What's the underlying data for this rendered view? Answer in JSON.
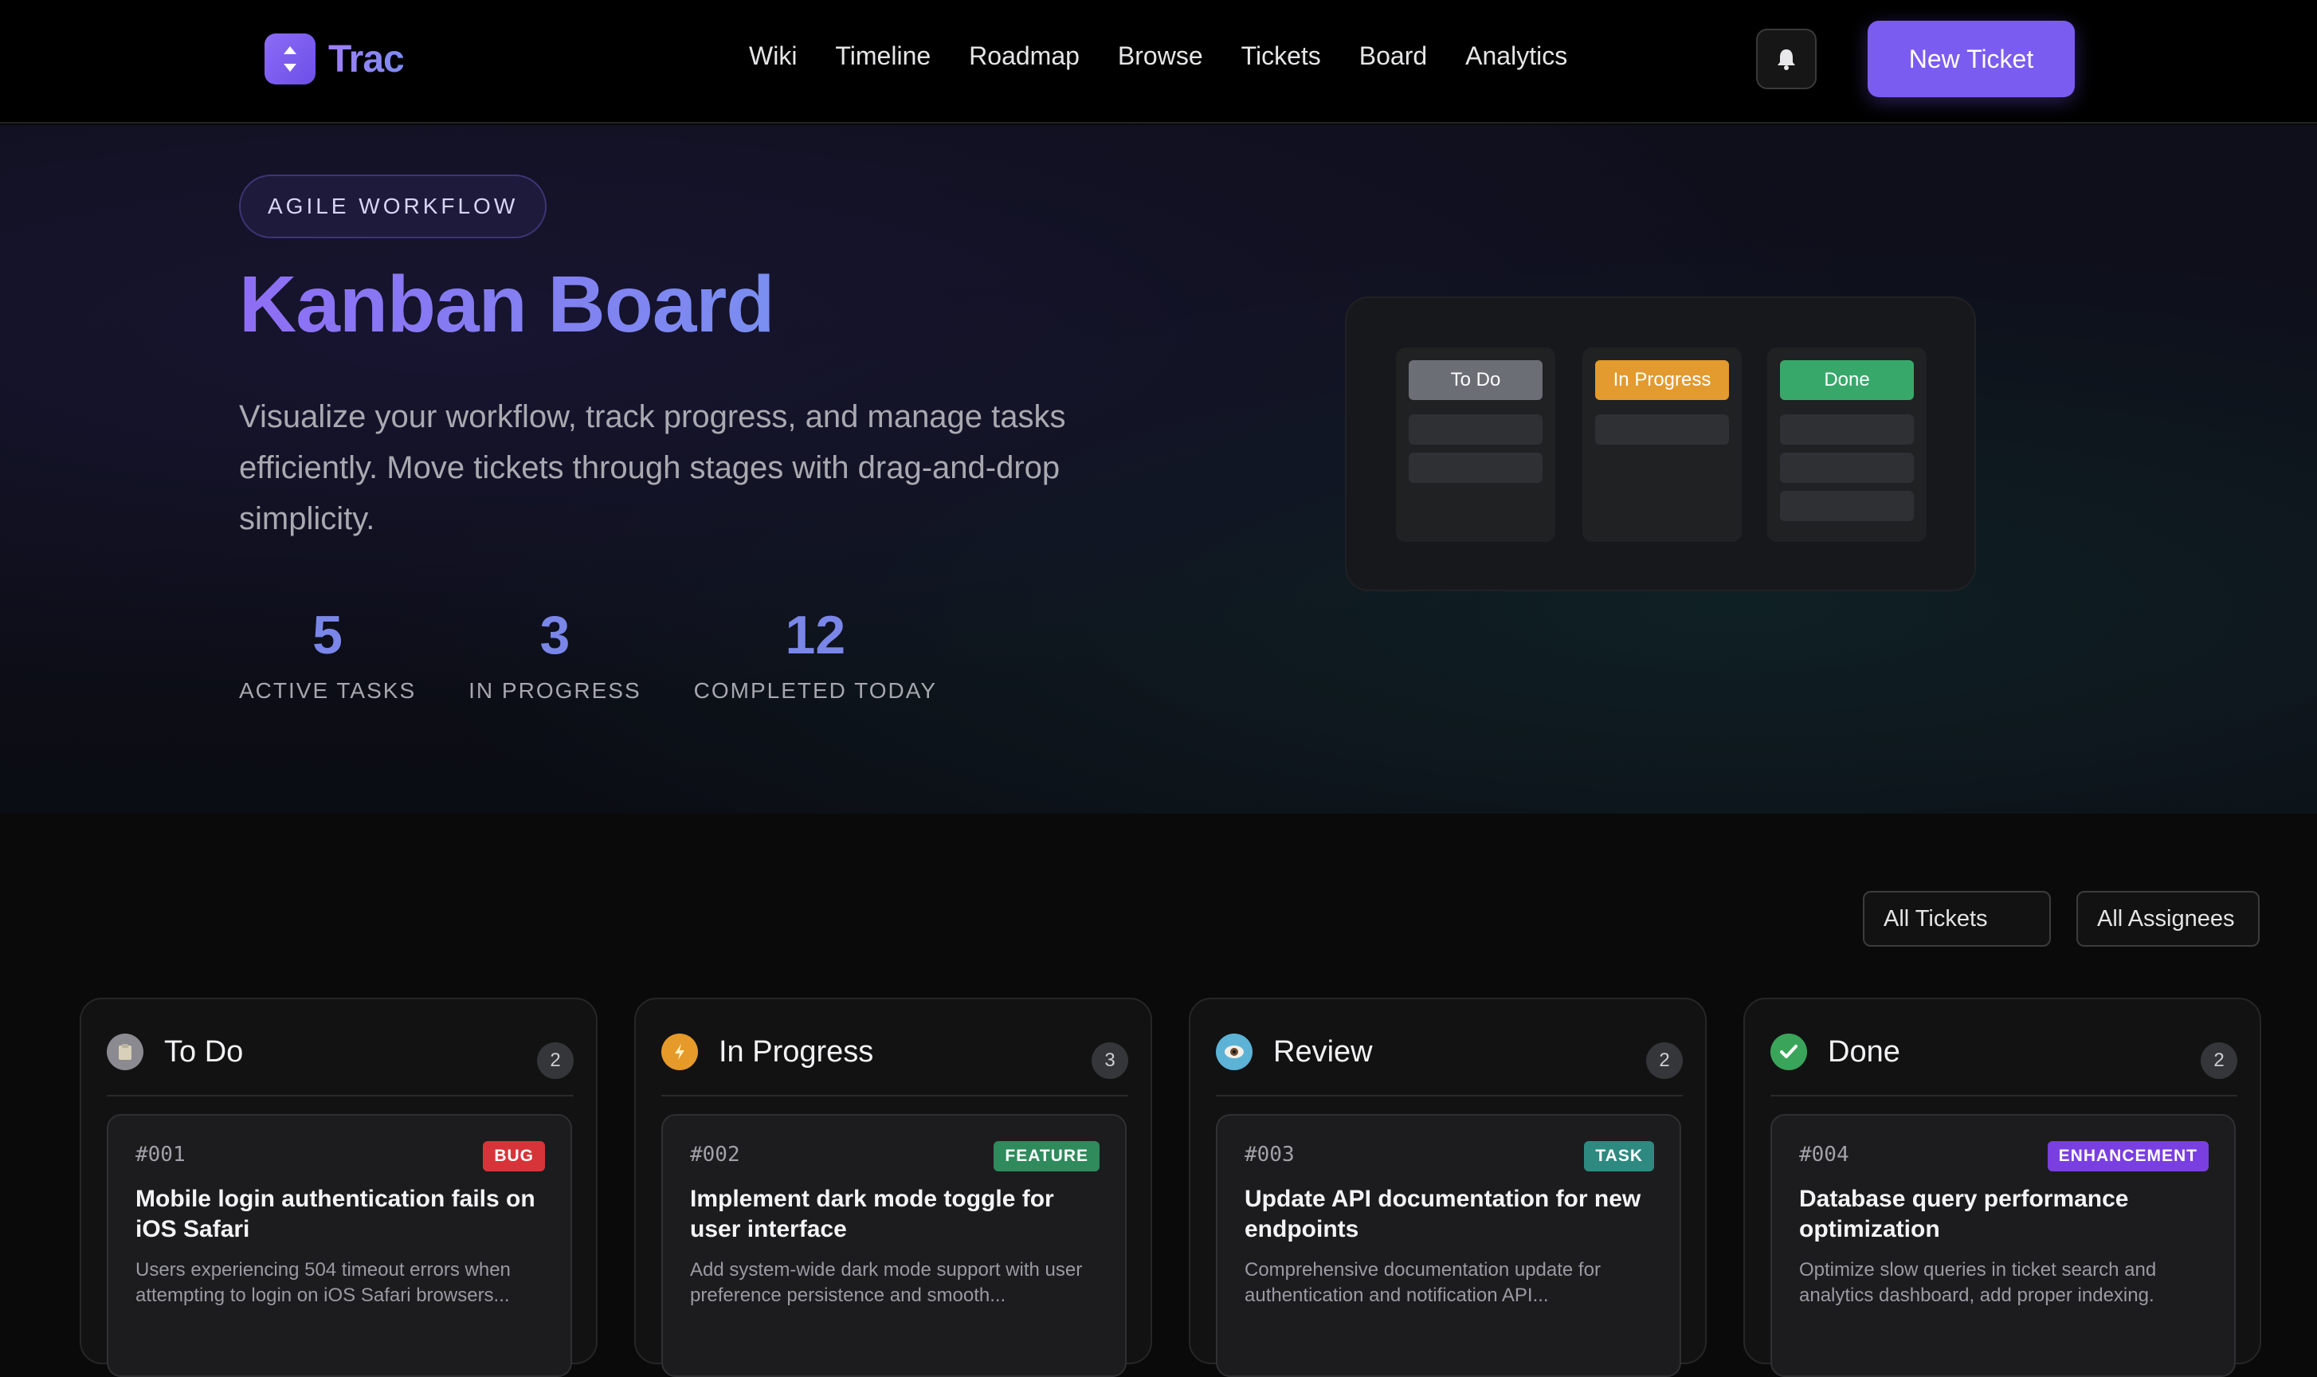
{
  "nav": {
    "brand": "Trac",
    "links": [
      "Wiki",
      "Timeline",
      "Roadmap",
      "Browse",
      "Tickets",
      "Board",
      "Analytics"
    ],
    "new_ticket_label": "New Ticket"
  },
  "hero": {
    "eyebrow": "AGILE WORKFLOW",
    "title": "Kanban Board",
    "description": "Visualize your workflow, track progress, and manage tasks efficiently. Move tickets through stages with drag-and-drop simplicity.",
    "stats": [
      {
        "value": "5",
        "label": "ACTIVE TASKS"
      },
      {
        "value": "3",
        "label": "IN PROGRESS"
      },
      {
        "value": "12",
        "label": "COMPLETED TODAY"
      }
    ],
    "mini_board": {
      "columns": [
        {
          "label": "To Do",
          "color": "#6b6e75",
          "cards": 2
        },
        {
          "label": "In Progress",
          "color": "#e39a2e",
          "cards": 1
        },
        {
          "label": "Done",
          "color": "#38a86a",
          "cards": 3
        }
      ]
    }
  },
  "filters": {
    "tickets": "All Tickets",
    "assignees": "All Assignees"
  },
  "columns": [
    {
      "title": "To Do",
      "count": "2",
      "icon": "clipboard-icon",
      "icon_color": "#8a8a90",
      "ticket": {
        "id": "#001",
        "badge": "BUG",
        "badge_color": "#d7343a",
        "title": "Mobile login authentication fails on iOS Safari",
        "description": "Users experiencing 504 timeout errors when attempting to login on iOS Safari browsers..."
      }
    },
    {
      "title": "In Progress",
      "count": "3",
      "icon": "lightning-icon",
      "icon_color": "#e59a2a",
      "ticket": {
        "id": "#002",
        "badge": "FEATURE",
        "badge_color": "#2f8a5c",
        "title": "Implement dark mode toggle for user interface",
        "description": "Add system-wide dark mode support with user preference persistence and smooth..."
      }
    },
    {
      "title": "Review",
      "count": "2",
      "icon": "eye-icon",
      "icon_color": "#5cb3d6",
      "ticket": {
        "id": "#003",
        "badge": "TASK",
        "badge_color": "#2e8a80",
        "title": "Update API documentation for new endpoints",
        "description": "Comprehensive documentation update for authentication and notification API..."
      }
    },
    {
      "title": "Done",
      "count": "2",
      "icon": "checkmark-icon",
      "icon_color": "#3aa55a",
      "ticket": {
        "id": "#004",
        "badge": "ENHANCEMENT",
        "badge_color": "#7a3fe0",
        "title": "Database query performance optimization",
        "description": "Optimize slow queries in ticket search and analytics dashboard, add proper indexing."
      }
    }
  ]
}
